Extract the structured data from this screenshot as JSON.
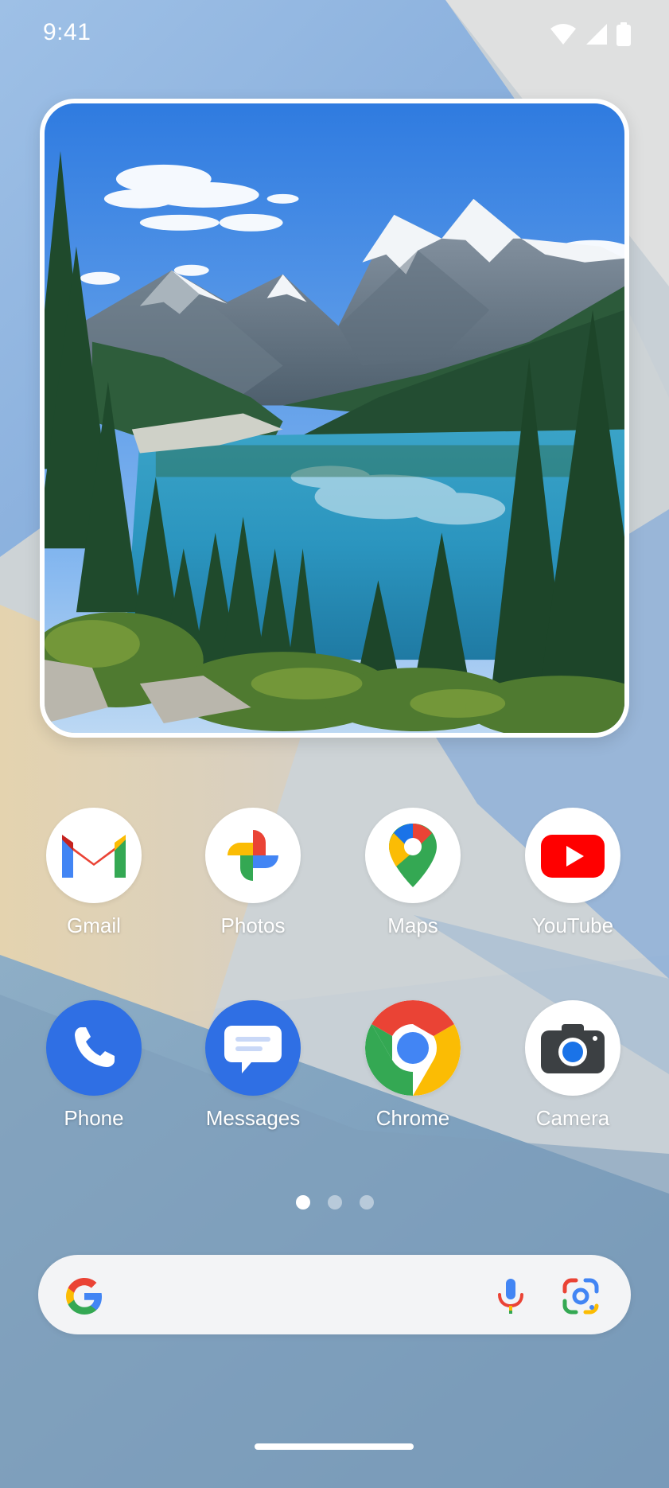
{
  "status_bar": {
    "time": "9:41",
    "icons": [
      "wifi-icon",
      "signal-icon",
      "battery-icon"
    ]
  },
  "widget": {
    "type": "photo",
    "icon": "landscape-photo"
  },
  "apps": [
    {
      "label": "Gmail",
      "icon": "gmail-icon"
    },
    {
      "label": "Photos",
      "icon": "photos-icon"
    },
    {
      "label": "Maps",
      "icon": "maps-icon"
    },
    {
      "label": "YouTube",
      "icon": "youtube-icon"
    },
    {
      "label": "Phone",
      "icon": "phone-icon"
    },
    {
      "label": "Messages",
      "icon": "messages-icon"
    },
    {
      "label": "Chrome",
      "icon": "chrome-icon"
    },
    {
      "label": "Camera",
      "icon": "camera-icon"
    }
  ],
  "page_indicator": {
    "pages": 3,
    "active": 0
  },
  "search_bar": {
    "placeholder": "",
    "icons": [
      "google-g-icon",
      "microphone-icon",
      "google-lens-icon"
    ]
  },
  "colors": {
    "google_blue": "#4285F4",
    "google_red": "#EA4335",
    "google_yellow": "#FBBC04",
    "google_green": "#34A853",
    "youtube_red": "#FF0000",
    "phone_blue": "#2F6FE4"
  }
}
